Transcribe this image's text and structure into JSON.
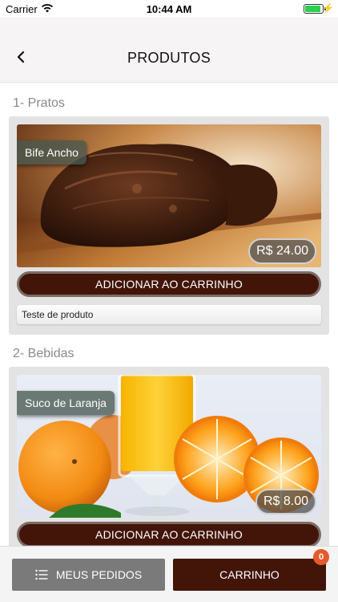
{
  "status_bar": {
    "carrier": "Carrier",
    "time": "10:44 AM",
    "battery_level": 0.9
  },
  "nav": {
    "title": "PRODUTOS"
  },
  "sections": [
    {
      "title": "1- Pratos",
      "products": [
        {
          "name": "Bife Ancho",
          "price": "R$ 24.00",
          "add_label": "ADICIONAR AO CARRINHO",
          "description": "Teste de produto"
        }
      ]
    },
    {
      "title": "2- Bebidas",
      "products": [
        {
          "name": "Suco de Laranja",
          "price": "R$ 8.00",
          "add_label": "ADICIONAR AO CARRINHO"
        }
      ]
    }
  ],
  "bottom": {
    "orders_label": "MEUS PEDIDOS",
    "cart_label": "CARRINHO",
    "cart_count": "0"
  },
  "colors": {
    "brand_dark": "#421508",
    "badge": "#e45a2b",
    "secondary_button": "#7a7a7a"
  }
}
